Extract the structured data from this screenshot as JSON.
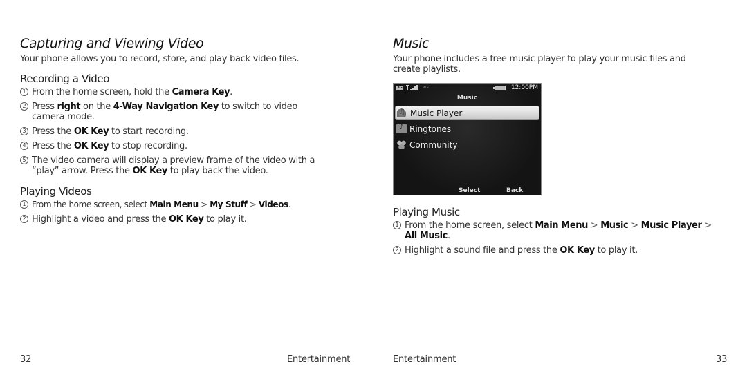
{
  "left_page": {
    "title": "Capturing and Viewing Video",
    "intro": "Your phone allows you to record, store, and play back video files.",
    "recording": {
      "heading": "Recording a Video",
      "steps": [
        {
          "num": "1",
          "pre": "From the home screen, hold the ",
          "b1": "Camera Key",
          "post": "."
        },
        {
          "num": "2",
          "pre": "Press ",
          "b1": "right",
          "mid": " on the ",
          "b2": "4-Way Navigation Key",
          "post": " to switch to video camera mode."
        },
        {
          "num": "3",
          "pre": "Press the ",
          "b1": "OK Key",
          "post": " to start recording."
        },
        {
          "num": "4",
          "pre": "Press the ",
          "b1": "OK Key",
          "post": " to stop recording."
        },
        {
          "num": "5",
          "pre": "The video camera will display a preview frame of the video with a “play” arrow. Press the ",
          "b1": "OK Key",
          "post": " to play back the video."
        }
      ]
    },
    "playing": {
      "heading": "Playing Videos",
      "steps": [
        {
          "num": "1",
          "pre": "From the home screen, select ",
          "b1": "Main Menu",
          "sep1": " > ",
          "b2": "My Stuff",
          "sep2": " > ",
          "b3": "Videos",
          "post": "."
        },
        {
          "num": "2",
          "pre": "Highlight a video and press the ",
          "b1": "OK Key",
          "post": " to play it."
        }
      ]
    },
    "footer": {
      "page_number": "32",
      "section": "Entertainment"
    }
  },
  "right_page": {
    "title": "Music",
    "intro": "Your phone includes a free music player to play your music files and create playlists.",
    "phone_screen": {
      "status": {
        "network": "3G",
        "carrier": "AT&T",
        "time": "12:00PM"
      },
      "title": "Music",
      "menu": [
        {
          "label": "Music Player",
          "icon": "music-player-icon",
          "selected": true
        },
        {
          "label": "Ringtones",
          "icon": "ringtones-folder-icon",
          "selected": false
        },
        {
          "label": "Community",
          "icon": "community-icon",
          "selected": false
        }
      ],
      "softkeys": {
        "left": "Select",
        "right": "Back"
      }
    },
    "playing": {
      "heading": "Playing Music",
      "steps": [
        {
          "num": "1",
          "pre": "From the home screen, select ",
          "b1": "Main Menu",
          "sep1": " > ",
          "b2": "Music",
          "sep2": " > ",
          "b3": "Music Player",
          "sep3": " > ",
          "b4": "All Music",
          "post": "."
        },
        {
          "num": "2",
          "pre": "Highlight a sound file and press the ",
          "b1": "OK Key",
          "post": " to play it."
        }
      ]
    },
    "footer": {
      "page_number": "33",
      "section": "Entertainment"
    }
  }
}
